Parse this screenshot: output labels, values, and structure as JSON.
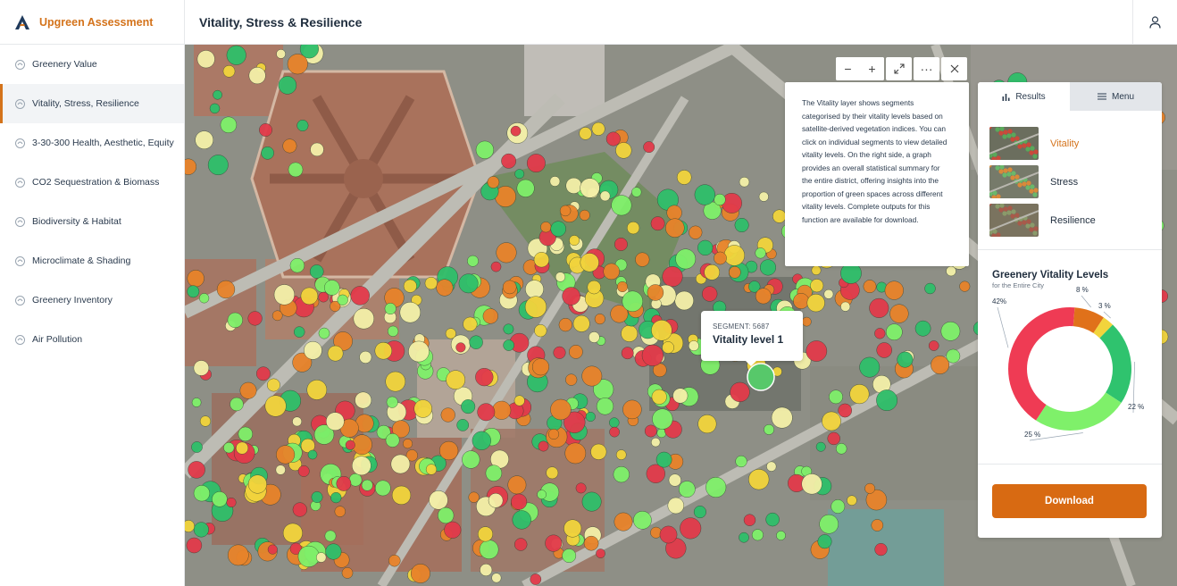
{
  "app": {
    "name": "Upgreen Assessment"
  },
  "header": {
    "title": "Vitality, Stress & Resilience"
  },
  "sidebar": {
    "items": [
      {
        "label": "Greenery Value",
        "icon": "greenery-value-icon"
      },
      {
        "label": "Vitality, Stress, Resilience",
        "icon": "vitality-icon"
      },
      {
        "label": "3-30-300 Health, Aesthetic, Equity",
        "icon": "health-icon"
      },
      {
        "label": "CO2 Sequestration & Biomass",
        "icon": "co2-icon"
      },
      {
        "label": "Biodiversity & Habitat",
        "icon": "biodiversity-icon"
      },
      {
        "label": "Microclimate & Shading",
        "icon": "microclimate-icon"
      },
      {
        "label": "Greenery Inventory",
        "icon": "inventory-icon"
      },
      {
        "label": "Air Pollution",
        "icon": "air-pollution-icon"
      }
    ],
    "active_index": 1
  },
  "map": {
    "toolbar": {
      "zoom_out": "−",
      "zoom_in": "+",
      "fullscreen": "⤢",
      "more": "···",
      "close": "✕"
    },
    "info": "The Vitality layer shows segments categorised by their vitality levels based on satellite-derived vegetation indices. You can click on individual segments to view detailed vitality levels. On the right side, a graph provides an overall statistical summary for the entire district, offering insights into the proportion of green spaces across different vitality levels. Complete outputs for this function are available for download.",
    "segment": {
      "id_label": "SEGMENT: 5687",
      "level": "Vitality level 1"
    }
  },
  "panel": {
    "tabs": {
      "results": "Results",
      "menu": "Menu"
    },
    "layers": [
      {
        "label": "Vitality",
        "active": true
      },
      {
        "label": "Stress",
        "active": false
      },
      {
        "label": "Resilience",
        "active": false
      }
    ],
    "chart_title": "Greenery Vitality Levels",
    "chart_subtitle": "for the Entire City",
    "download": "Download"
  },
  "colors": {
    "accent": "#d4731b",
    "download": "#d86a12",
    "veg_red": "#e23a4a",
    "veg_orange": "#e8832a",
    "veg_yellow": "#f2d43c",
    "veg_green": "#2fbf6a",
    "veg_lightgreen": "#7ff06a"
  },
  "chart_data": {
    "type": "pie",
    "title": "Greenery Vitality Levels",
    "subtitle": "for the Entire City",
    "categories": [
      "",
      "",
      "",
      "",
      ""
    ],
    "values": [
      42,
      8,
      3,
      22,
      25
    ],
    "labels": [
      "42%",
      "8 %",
      "3 %",
      "22 %",
      "25 %"
    ],
    "colors": [
      "#ef3b54",
      "#e0711a",
      "#f2d43c",
      "#2fc36e",
      "#7ff06a"
    ],
    "donut": true
  }
}
